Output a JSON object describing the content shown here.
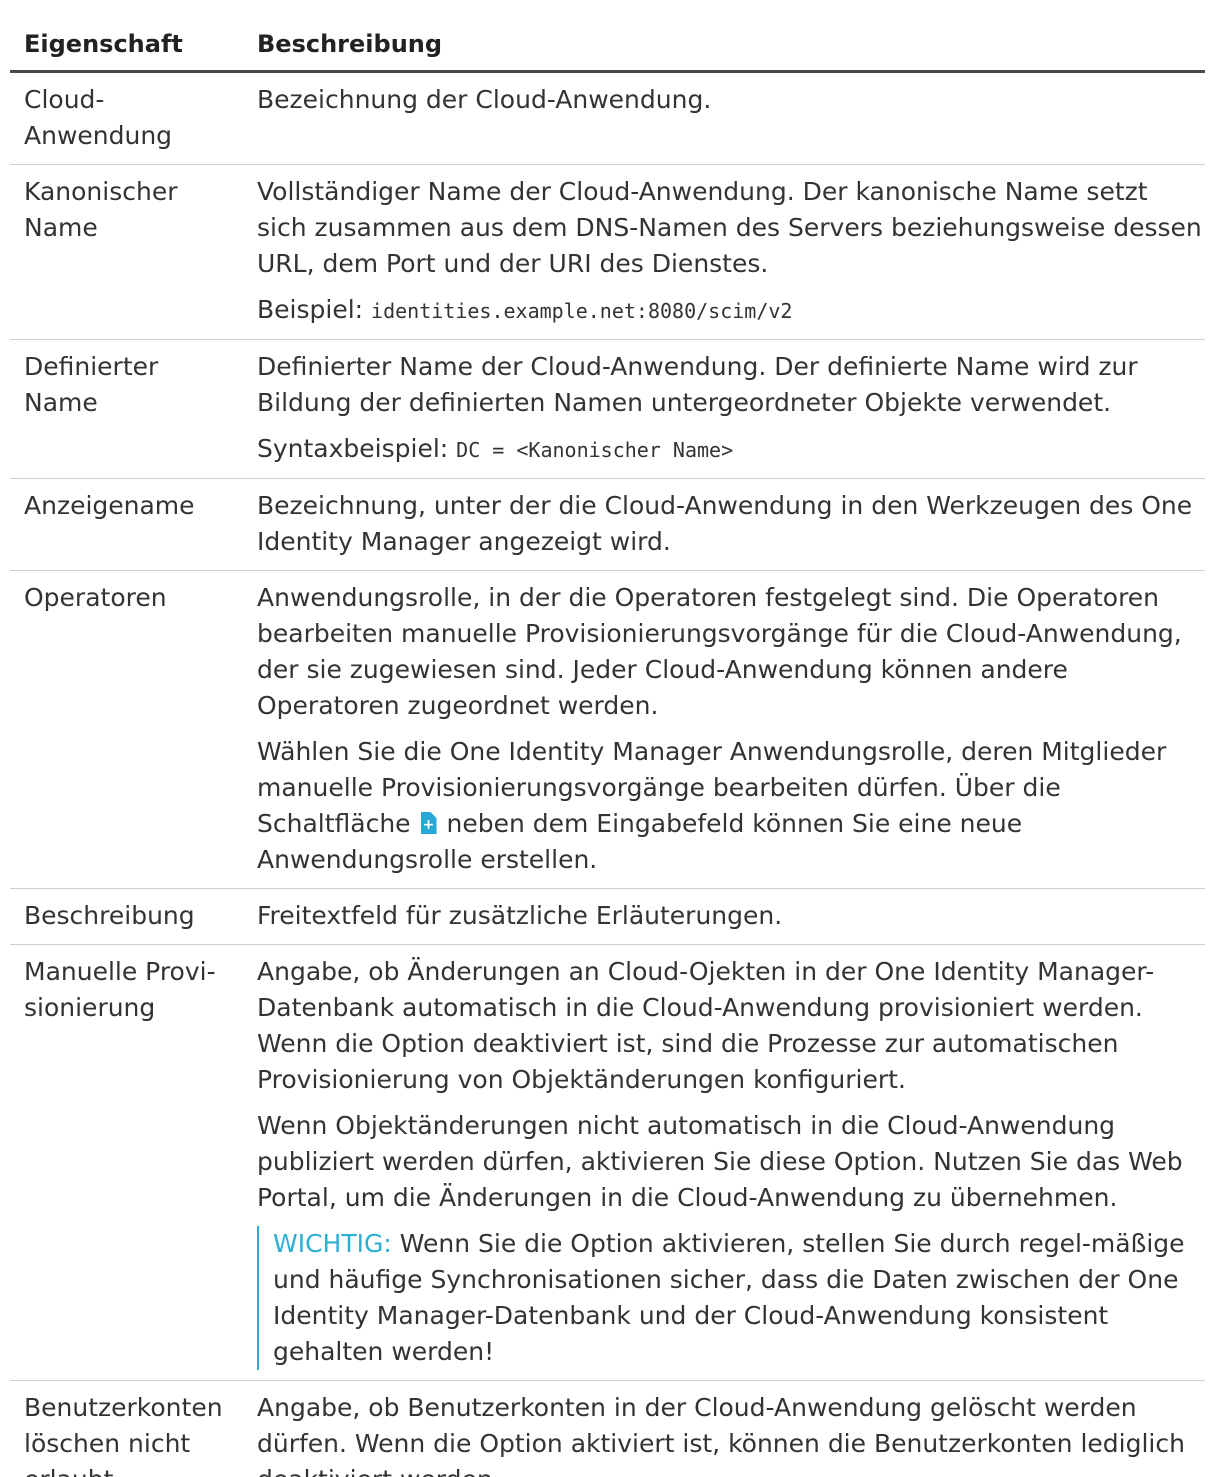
{
  "table": {
    "headers": {
      "property": "Eigenschaft",
      "description": "Beschreibung"
    },
    "rows": [
      {
        "property": "Cloud-Anwendung",
        "paragraphs": [
          "Bezeichnung der Cloud-Anwendung."
        ]
      },
      {
        "property": "Kanonischer Name",
        "paragraphs": [
          "Vollständiger Name der Cloud-Anwendung. Der kanonische Name setzt sich zusammen aus dem DNS-Namen des Servers beziehungsweise dessen URL, dem Port und der URI des Dienstes."
        ],
        "example_label": "Beispiel:",
        "example_value": "identities.example.net:8080/scim/v2"
      },
      {
        "property": "Definierter Name",
        "paragraphs": [
          "Definierter Name der Cloud-Anwendung. Der definierte Name wird zur Bildung der definierten Namen untergeordneter Objekte verwendet."
        ],
        "example_label": "Syntaxbeispiel:",
        "example_value": "DC = <Kanonischer Name>"
      },
      {
        "property": "Anzeigename",
        "paragraphs": [
          "Bezeichnung, unter der die Cloud-Anwendung in den Werkzeugen des One Identity Manager angezeigt wird."
        ]
      },
      {
        "property": "Operatoren",
        "paragraphs": [
          "Anwendungsrolle, in der die Operatoren festgelegt sind. Die Operatoren bearbeiten manuelle Provisionierungsvorgänge für die Cloud-Anwendung, der sie zugewiesen sind. Jeder Cloud-Anwendung können andere Operatoren zugeordnet werden."
        ],
        "icon_paragraph_before": "Wählen Sie die One Identity Manager Anwendungsrolle, deren Mitglieder manuelle Provisionierungsvorgänge bearbeiten dürfen. Über die Schaltfläche",
        "icon_name": "new-document-plus-icon",
        "icon_paragraph_after": "neben dem Eingabefeld können Sie eine neue Anwendungsrolle erstellen."
      },
      {
        "property": "Beschreibung",
        "paragraphs": [
          "Freitextfeld für zusätzliche Erläuterungen."
        ]
      },
      {
        "property": "Manuelle Provi-sionierung",
        "paragraphs": [
          "Angabe, ob Änderungen an Cloud-Ojekten in der One Identity Manager-Datenbank automatisch in die Cloud-Anwendung provisioniert werden. Wenn die Option deaktiviert ist, sind die Prozesse zur automatischen Provisionierung von Objektänderungen konfiguriert.",
          "Wenn Objektänderungen nicht automatisch in die Cloud-Anwendung publiziert werden dürfen, aktivieren Sie diese Option. Nutzen Sie das Web Portal, um die Änderungen in die Cloud-Anwendung zu übernehmen."
        ],
        "note_label": "WICHTIG:",
        "note_text": "Wenn Sie die Option aktivieren, stellen Sie durch regel-mäßige und häufige Synchronisationen sicher, dass die Daten zwischen der One Identity Manager-Datenbank und der Cloud-Anwendung konsistent gehalten werden!"
      },
      {
        "property": "Benutzerkonten löschen nicht erlaubt",
        "paragraphs": [
          "Angabe, ob Benutzerkonten in der Cloud-Anwendung gelöscht werden dürfen. Wenn die Option aktiviert ist, können die Benutzerkonten lediglich deaktiviert werden."
        ]
      }
    ]
  },
  "colors": {
    "text": "#333333",
    "note_accent": "#2bafd4",
    "icon_blue": "#27a7d6",
    "header_rule": "#4a4a4a",
    "row_rule": "#cfcfcf"
  }
}
